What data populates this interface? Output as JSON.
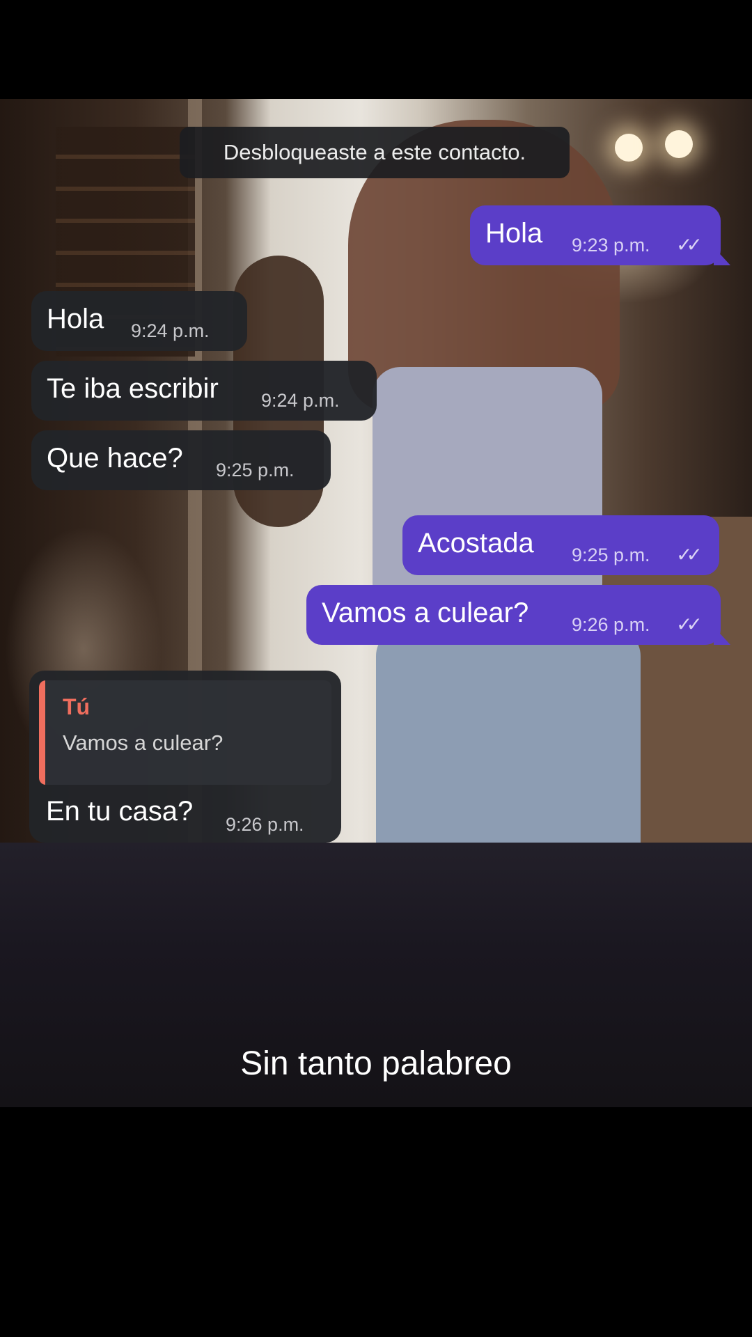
{
  "system_message": "Desbloqueaste a este contacto.",
  "messages": [
    {
      "direction": "out",
      "text": "Hola",
      "time": "9:23 p.m.",
      "status": "read"
    },
    {
      "direction": "in",
      "text": "Hola",
      "time": "9:24 p.m."
    },
    {
      "direction": "in",
      "text": "Te iba escribir",
      "time": "9:24 p.m."
    },
    {
      "direction": "in",
      "text": "Que hace?",
      "time": "9:25 p.m."
    },
    {
      "direction": "out",
      "text": "Acostada",
      "time": "9:25 p.m.",
      "status": "read"
    },
    {
      "direction": "out",
      "text": "Vamos a culear?",
      "time": "9:26 p.m.",
      "status": "read"
    },
    {
      "direction": "in",
      "text": "En tu casa?",
      "time": "9:26 p.m.",
      "reply_to": {
        "author": "Tú",
        "text": "Vamos a culear?"
      }
    }
  ],
  "read_tick": "✓✓",
  "caption": "Sin tanto palabreo",
  "colors": {
    "outgoing_bubble": "#5b3ec8",
    "incoming_bubble": "#222429",
    "reply_accent": "#f06e5e"
  }
}
